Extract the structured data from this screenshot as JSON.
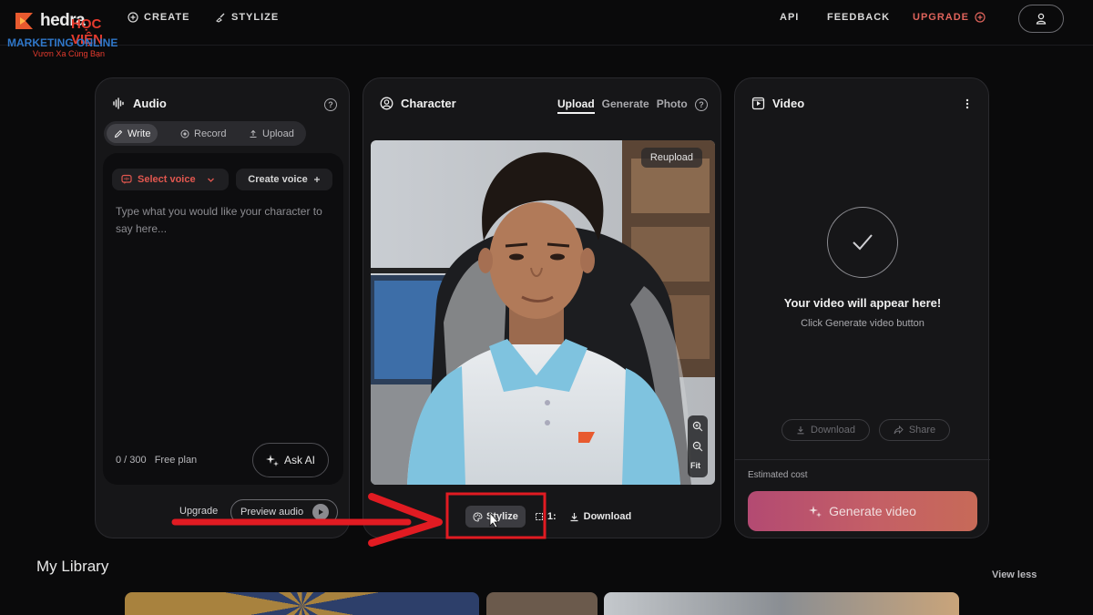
{
  "nav": {
    "brand": "hedra",
    "watermark_name": "HỌC VIỆN",
    "watermark_sub": "MARKETING ONLINE",
    "watermark_tagline": "Vươn Xa Cùng Bạn",
    "create_label": "CREATE",
    "stylize_label": "STYLIZE",
    "api_label": "API",
    "feedback_label": "FEEDBACK",
    "upgrade_label": "UPGRADE"
  },
  "audio": {
    "title": "Audio",
    "help": "?",
    "tabs": [
      {
        "label": "Write",
        "active": true,
        "icon": "pencil-icon"
      },
      {
        "label": "Record",
        "active": false,
        "icon": "record-icon"
      },
      {
        "label": "Upload",
        "active": false,
        "icon": "upload-icon"
      }
    ],
    "select_voice_label": "Select voice",
    "create_voice_label": "Create voice",
    "placeholder": "Type what you would like your character to say here...",
    "counter": "0 / 300",
    "plan": "Free plan",
    "ask_ai_label": "Ask AI",
    "upgrade_label": "Upgrade",
    "preview_label": "Preview audio"
  },
  "character": {
    "title": "Character",
    "tabs": [
      {
        "label": "Upload",
        "active": true
      },
      {
        "label": "Generate",
        "active": false
      },
      {
        "label": "Photo",
        "active": false
      }
    ],
    "help": "?",
    "reupload_label": "Reupload",
    "fit_label": "Fit",
    "stylize_label": "Stylize",
    "ratio_label": "1:",
    "download_label": "Download"
  },
  "video": {
    "title": "Video",
    "empty_title": "Your video will appear here!",
    "empty_sub": "Click Generate video button",
    "download_label": "Download",
    "share_label": "Share",
    "est_cost_label": "Estimated cost",
    "generate_label": "Generate video"
  },
  "library": {
    "title": "My Library",
    "view_less_label": "View less"
  },
  "colors": {
    "accent_red": "#e2574f",
    "generate_gradient_start": "#b34a72",
    "generate_gradient_end": "#c76a58",
    "annotation_red": "#e11b22"
  }
}
